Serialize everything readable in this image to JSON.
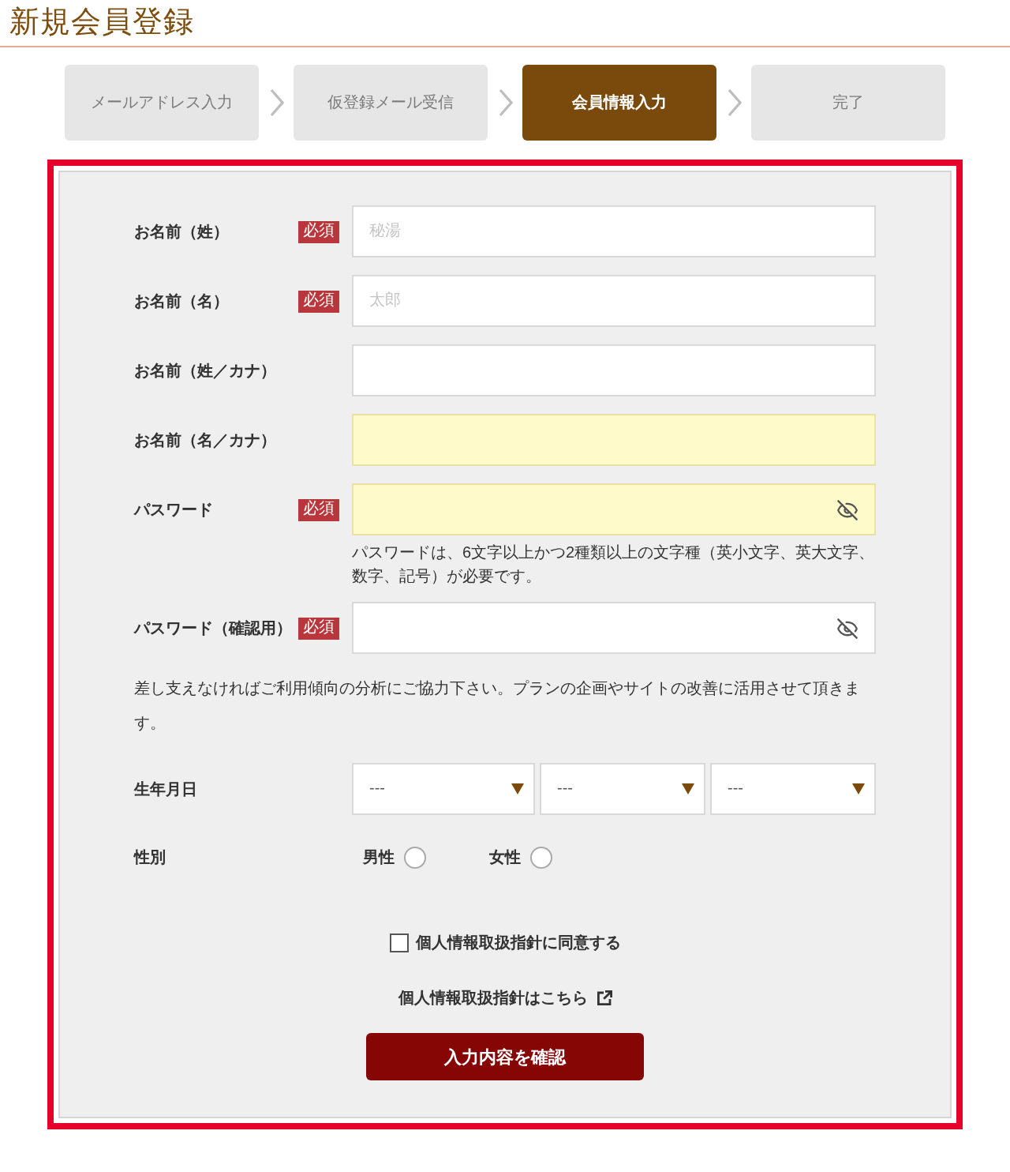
{
  "title": "新規会員登録",
  "steps": [
    {
      "label": "メールアドレス入力",
      "selected": false
    },
    {
      "label": "仮登録メール受信",
      "selected": false
    },
    {
      "label": "会員情報入力",
      "selected": true
    },
    {
      "label": "完了",
      "selected": false
    }
  ],
  "form": {
    "fields": [
      {
        "kind": "text",
        "label": "お名前（姓）",
        "required": true,
        "badge": "必須",
        "placeholder": "秘湯",
        "highlighted": false
      },
      {
        "kind": "text",
        "label": "お名前（名）",
        "required": true,
        "badge": "必須",
        "placeholder": "太郎",
        "highlighted": false
      },
      {
        "kind": "text",
        "label": "お名前（姓／カナ）",
        "required": false,
        "highlighted": false
      },
      {
        "kind": "text",
        "label": "お名前（名／カナ）",
        "required": false,
        "highlighted": true
      },
      {
        "kind": "password",
        "label": "パスワード",
        "required": true,
        "badge": "必須",
        "highlighted": true,
        "hint": "パスワードは、6文字以上かつ2種類以上の文字種（英小文字、英大文字、数字、記号）が必要です。"
      },
      {
        "kind": "password",
        "label": "パスワード（確認用）",
        "required": true,
        "badge": "必須",
        "highlighted": false
      }
    ],
    "note": "差し支えなければご利用傾向の分析にご協力下さい。プランの企画やサイトの改善に活用させて頂きます。",
    "birthdate": {
      "label": "生年月日",
      "selects": [
        {
          "value": "---"
        },
        {
          "value": "---"
        },
        {
          "value": "---"
        }
      ]
    },
    "gender": {
      "label": "性別",
      "options": [
        {
          "label": "男性",
          "selected": false
        },
        {
          "label": "女性",
          "selected": false
        }
      ]
    },
    "consent": {
      "label": "個人情報取扱指針に同意する",
      "checked": false
    },
    "policy_link": "個人情報取扱指針はこちら",
    "submit": "入力内容を確認"
  }
}
